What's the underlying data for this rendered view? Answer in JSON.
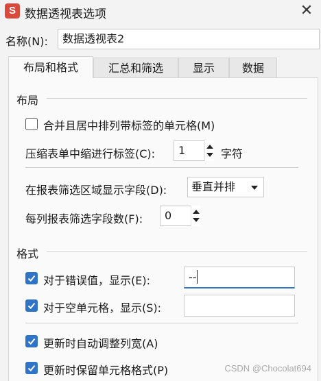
{
  "window": {
    "app_icon_letter": "S",
    "title": "数据透视表选项",
    "close_glyph": "✕"
  },
  "name": {
    "label": "名称(N):",
    "value": "数据透视表2"
  },
  "tabs": [
    {
      "label": "布局和格式",
      "active": true
    },
    {
      "label": "汇总和筛选",
      "active": false
    },
    {
      "label": "显示",
      "active": false
    },
    {
      "label": "数据",
      "active": false
    }
  ],
  "layout": {
    "title": "布局",
    "merge_center": {
      "label": "合并且居中排列带标签的单元格(M)",
      "checked": false
    },
    "compact_indent": {
      "label": "压缩表单中缩进行标签(C):",
      "value": "1",
      "unit": "字符"
    },
    "filter_area_display": {
      "label": "在报表筛选区域显示字段(D):",
      "value": "垂直并排"
    },
    "filter_fields_per_column": {
      "label": "每列报表筛选字段数(F):",
      "value": "0"
    }
  },
  "format": {
    "title": "格式",
    "error_values": {
      "label": "对于错误值，显示(E):",
      "checked": true,
      "value": "--"
    },
    "empty_cells": {
      "label": "对于空单元格，显示(S):",
      "checked": true,
      "value": ""
    },
    "autofit_columns": {
      "label": "更新时自动调整列宽(A)",
      "checked": true
    },
    "preserve_formatting": {
      "label": "更新时保留单元格格式(P)",
      "checked": true
    }
  },
  "watermark": "CSDN @Chocolat694",
  "colors": {
    "accent": "#2f74c6",
    "app_icon": "#d94a3d"
  }
}
